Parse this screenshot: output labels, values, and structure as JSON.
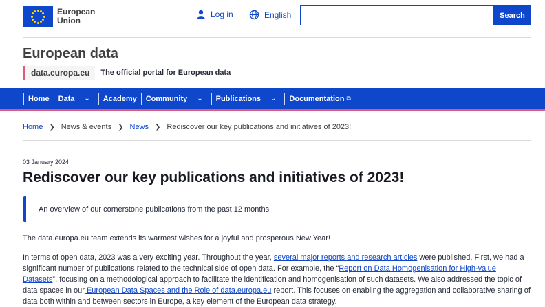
{
  "header": {
    "logo_line1": "European",
    "logo_line2": "Union",
    "login_label": "Log in",
    "language_label": "English",
    "search_placeholder": "",
    "search_button": "Search"
  },
  "site": {
    "title": "European data",
    "portal_tag": "data.europa.eu",
    "portal_description": "The official portal for European data"
  },
  "nav": {
    "items": [
      {
        "label": "Home",
        "has_dropdown": false
      },
      {
        "label": "Data",
        "has_dropdown": true
      },
      {
        "label": "Academy",
        "has_dropdown": false
      },
      {
        "label": "Community",
        "has_dropdown": true
      },
      {
        "label": "Publications",
        "has_dropdown": true
      },
      {
        "label": "Documentation",
        "has_dropdown": false,
        "external": true
      }
    ]
  },
  "breadcrumb": {
    "home": "Home",
    "news_events": "News & events",
    "news": "News",
    "current": "Rediscover our key publications and initiatives of 2023!"
  },
  "article": {
    "date": "03 January 2024",
    "title": "Rediscover our key publications and initiatives of 2023!",
    "lead": "An overview of our cornerstone publications from the past 12 months",
    "paragraph1": "The data.europa.eu team extends its warmest wishes for a joyful and prosperous New Year!",
    "p2_part1": "In terms of open data, 2023 was a very exciting year. Throughout the year, ",
    "p2_link1": "several major reports and research articles",
    "p2_part2": " were published. First, we had a significant number of publications related to the technical side of open data. For example, the “",
    "p2_link2": "Report on Data Homogenisation for High-value Datasets",
    "p2_part3": "”, focusing on a methodological approach to facilitate the identification and homogenisation of such datasets. We also addressed the topic of data spaces in our",
    "p2_link3": " European Data Spaces and the Role of data.europa.eu",
    "p2_part4": " report. This focuses on enabling the aggregation and collaborative sharing of data both within and between sectors in Europe, a key element of the European data strategy."
  },
  "colors": {
    "primary": "#0e47cb",
    "accent_pink": "#e0587e",
    "flag_star": "#ffdd00"
  }
}
